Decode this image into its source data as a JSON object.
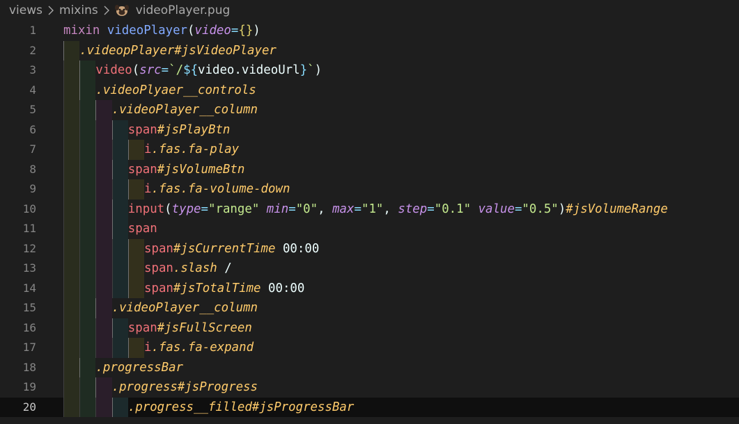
{
  "breadcrumb": {
    "items": [
      "views",
      "mixins",
      "videoPlayer.pug"
    ],
    "file_icon": "pug-icon",
    "separator_icon": "chevron-right-icon"
  },
  "editor": {
    "current_line": 20,
    "line_numbers": [
      "1",
      "2",
      "3",
      "4",
      "5",
      "6",
      "7",
      "8",
      "9",
      "10",
      "11",
      "12",
      "13",
      "14",
      "15",
      "16",
      "17",
      "18",
      "19",
      "20"
    ],
    "lines": [
      [
        [
          "kw",
          "mixin"
        ],
        [
          "txt",
          " "
        ],
        [
          "fn",
          "videoPlayer"
        ],
        [
          "paren",
          "("
        ],
        [
          "attr",
          "video"
        ],
        [
          "pun",
          "="
        ],
        [
          "brace",
          "{}"
        ],
        [
          "paren",
          ")"
        ]
      ],
      [
        [
          "cls",
          ".videopPlayer#jsVideoPlayer"
        ]
      ],
      [
        [
          "tag",
          "video"
        ],
        [
          "paren",
          "("
        ],
        [
          "attr",
          "src"
        ],
        [
          "pun",
          "="
        ],
        [
          "str",
          "`/"
        ],
        [
          "pun",
          "${"
        ],
        [
          "var",
          "video.videoUrl"
        ],
        [
          "pun",
          "}"
        ],
        [
          "str",
          "`"
        ],
        [
          "paren",
          ")"
        ]
      ],
      [
        [
          "cls",
          ".videoPlyaer__controls"
        ]
      ],
      [
        [
          "cls",
          ".videoPlayer__column"
        ]
      ],
      [
        [
          "tag",
          "span"
        ],
        [
          "cls",
          "#jsPlayBtn"
        ]
      ],
      [
        [
          "tag",
          "i"
        ],
        [
          "cls",
          ".fas.fa-play"
        ]
      ],
      [
        [
          "tag",
          "span"
        ],
        [
          "cls",
          "#jsVolumeBtn"
        ]
      ],
      [
        [
          "tag",
          "i"
        ],
        [
          "cls",
          ".fas.fa-volume-down"
        ]
      ],
      [
        [
          "tag",
          "input"
        ],
        [
          "paren",
          "("
        ],
        [
          "attr",
          "type"
        ],
        [
          "pun",
          "="
        ],
        [
          "str",
          "\"range\""
        ],
        [
          "txt",
          " "
        ],
        [
          "attr",
          "min"
        ],
        [
          "pun",
          "="
        ],
        [
          "str",
          "\"0\""
        ],
        [
          "txt",
          ", "
        ],
        [
          "attr",
          "max"
        ],
        [
          "pun",
          "="
        ],
        [
          "str",
          "\"1\""
        ],
        [
          "txt",
          ", "
        ],
        [
          "attr",
          "step"
        ],
        [
          "pun",
          "="
        ],
        [
          "str",
          "\"0.1\""
        ],
        [
          "txt",
          " "
        ],
        [
          "attr",
          "value"
        ],
        [
          "pun",
          "="
        ],
        [
          "str",
          "\"0.5\""
        ],
        [
          "paren",
          ")"
        ],
        [
          "cls",
          "#jsVolumeRange"
        ]
      ],
      [
        [
          "tag",
          "span"
        ]
      ],
      [
        [
          "tag",
          "span"
        ],
        [
          "cls",
          "#jsCurrentTime"
        ],
        [
          "txt",
          " 00:00"
        ]
      ],
      [
        [
          "tag",
          "span"
        ],
        [
          "cls",
          ".slash"
        ],
        [
          "txt",
          " /"
        ]
      ],
      [
        [
          "tag",
          "span"
        ],
        [
          "cls",
          "#jsTotalTime"
        ],
        [
          "txt",
          " 00:00"
        ]
      ],
      [
        [
          "cls",
          ".videoPlayer__column"
        ]
      ],
      [
        [
          "tag",
          "span"
        ],
        [
          "cls",
          "#jsFullScreen"
        ]
      ],
      [
        [
          "tag",
          "i"
        ],
        [
          "cls",
          ".fas.fa-expand"
        ]
      ],
      [
        [
          "cls",
          ".progressBar"
        ]
      ],
      [
        [
          "cls",
          ".progress#jsProgress"
        ]
      ],
      [
        [
          "cls",
          ".progress__filled#jsProgressBar"
        ]
      ]
    ],
    "indents": [
      0,
      1,
      2,
      2,
      3,
      4,
      5,
      4,
      5,
      4,
      4,
      5,
      5,
      5,
      3,
      4,
      5,
      2,
      3,
      4
    ]
  }
}
